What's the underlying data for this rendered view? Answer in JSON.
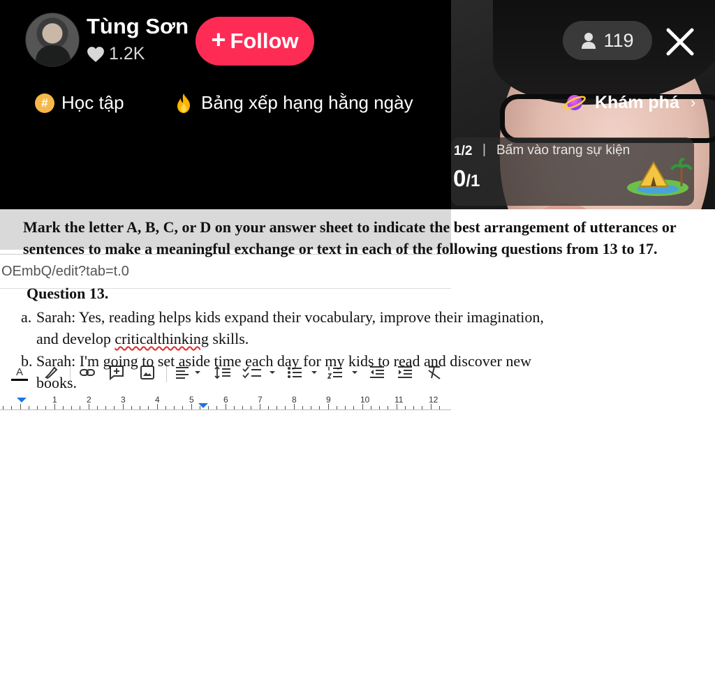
{
  "host": {
    "name": "Tùng Sơn",
    "likes": "1.2K",
    "follow_label": "Follow",
    "follow_plus": "+"
  },
  "category": {
    "icon_glyph": "#",
    "label": "Học tập"
  },
  "ranking": {
    "label": "Bảng xếp hạng hằng ngày"
  },
  "viewers": {
    "count": "119"
  },
  "explore": {
    "label": "Khám phá",
    "chevron": "›"
  },
  "event": {
    "step": "1/2",
    "separator": "|",
    "text": "Bấm vào trang sự kiện",
    "progress_num": "0",
    "progress_den": "/1"
  },
  "browser": {
    "address": "OEmbQ/edit?tab=t.0"
  },
  "ruler": {
    "numbers": [
      "1",
      "2",
      "3",
      "4",
      "5",
      "6",
      "7",
      "8",
      "9",
      "10",
      "11",
      "12"
    ]
  },
  "document": {
    "instruction": "Mark the letter A, B, C, or D on your answer sheet to indicate the best arrangement of utterances or sentences to make a meaningful exchange or text in each of the following questions from 13 to 17.",
    "question": "Question 13.",
    "option_a_label": "a.",
    "option_a_line1": "Sarah: Yes, reading helps kids expand their vocabulary, improve their imagination,",
    "option_a_line2_pre": "and develop ",
    "option_a_misspelled": "criticalthinking",
    "option_a_line2_post": " skills.",
    "option_b_label": "b.",
    "option_b_line1": "Sarah: I'm going to set aside time each day for my kids to read and discover new",
    "option_b_line2": "books."
  },
  "colors": {
    "follow": "#fe2c55",
    "background": "#000000",
    "doc_background": "#ffffff",
    "spell_underline": "#dd3333"
  }
}
